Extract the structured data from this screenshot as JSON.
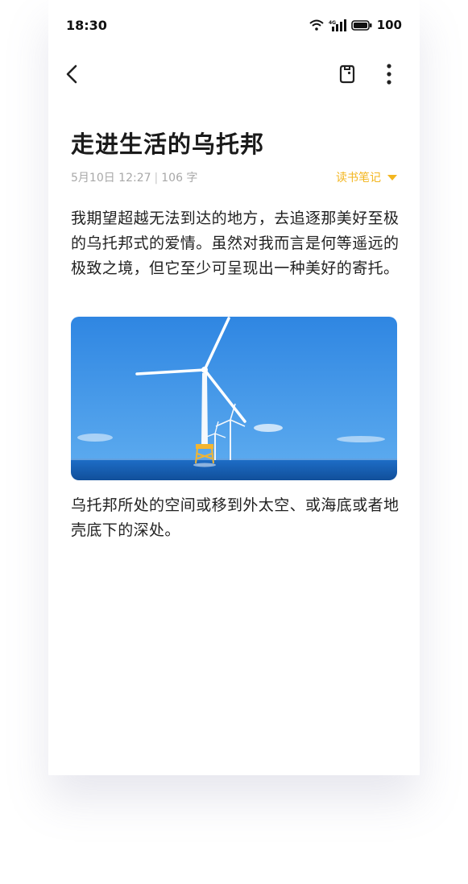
{
  "status_bar": {
    "time": "18:30",
    "network": "4G",
    "battery": "100"
  },
  "toolbar": {
    "back_icon": "chevron-left-icon",
    "note_icon": "note-tag-icon",
    "more_icon": "more-vertical-icon"
  },
  "note": {
    "title": "走进生活的乌托邦",
    "date": "5月10日 12:27",
    "word_count": "106 字",
    "category": "读书笔记",
    "paragraph1": "我期望超越无法到达的地方，去追逐那美好至极的乌托邦式的爱情。虽然对我而言是何等遥远的极致之境，但它至少可呈现出一种美好的寄托。",
    "paragraph2": "乌托邦所处的空间或移到外太空、或海底或者地壳底下的深处。"
  },
  "colors": {
    "accent": "#f3b61f",
    "meta_text": "#a8a8a8",
    "body_text": "#222222"
  }
}
